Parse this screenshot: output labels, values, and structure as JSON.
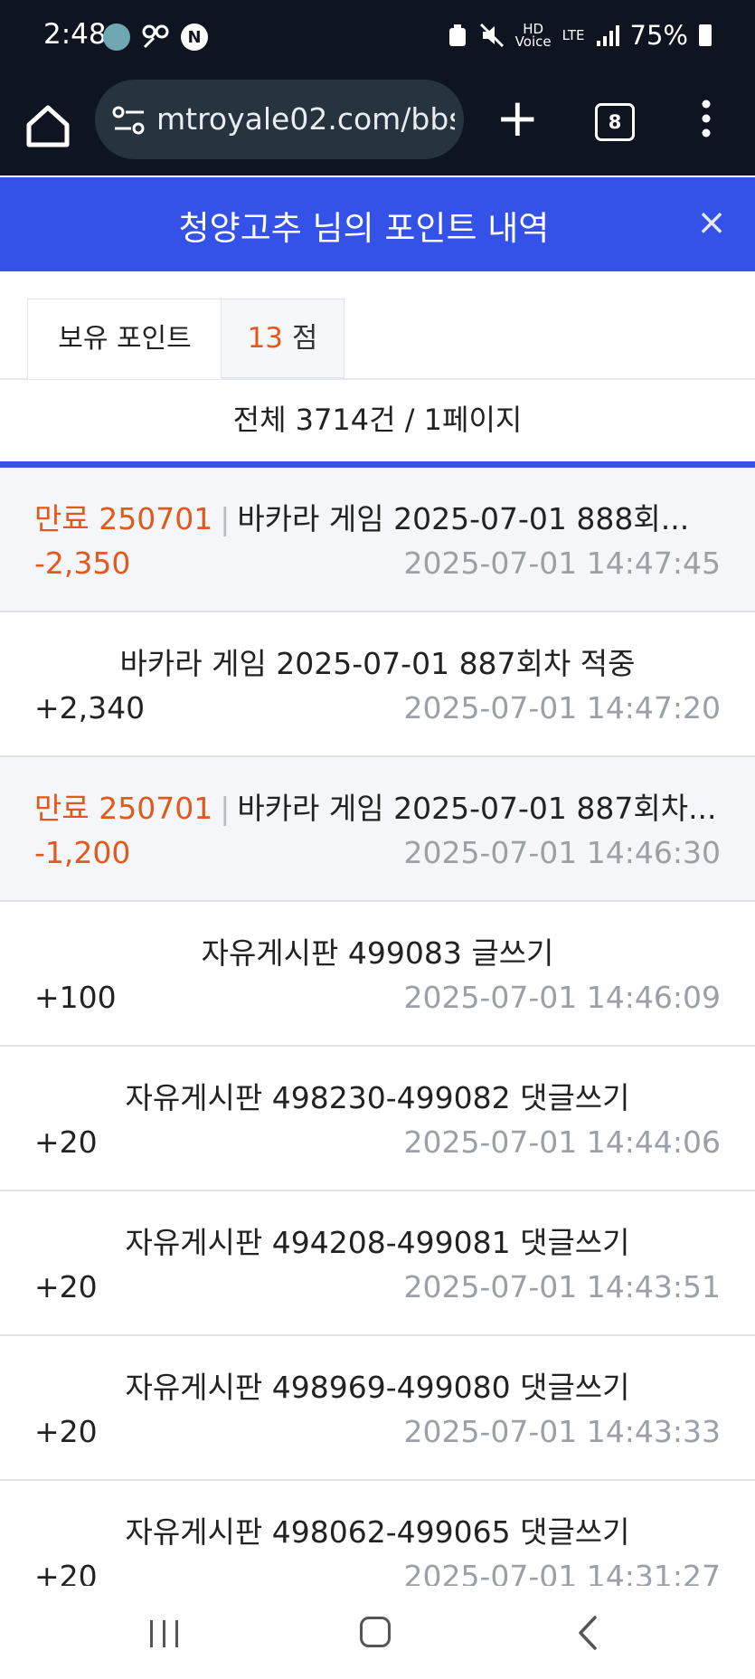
{
  "status_bar": {
    "time": "2:48",
    "hd_voice": "HD\nVoice",
    "network": "LTE",
    "battery": "75%"
  },
  "browser": {
    "url": "mtroyale02.com/bbs",
    "tab_count": "8"
  },
  "header": {
    "title": "청양고추 님의 포인트 내역",
    "close": "×"
  },
  "tabs": {
    "label": "보유 포인트",
    "points_value": "13",
    "points_unit": "점"
  },
  "summary": "전체 3714건 / 1페이지",
  "rows": [
    {
      "tag": "만료 250701",
      "desc": "바카라 게임 2025-07-01 888회...",
      "amount": "-2,350",
      "time": "2025-07-01 14:47:45",
      "negative": true
    },
    {
      "tag": "",
      "desc": "바카라 게임 2025-07-01 887회차 적중",
      "amount": "+2,340",
      "time": "2025-07-01 14:47:20",
      "negative": false
    },
    {
      "tag": "만료 250701",
      "desc": "바카라 게임 2025-07-01 887회차...",
      "amount": "-1,200",
      "time": "2025-07-01 14:46:30",
      "negative": true
    },
    {
      "tag": "",
      "desc": "자유게시판 499083 글쓰기",
      "amount": "+100",
      "time": "2025-07-01 14:46:09",
      "negative": false
    },
    {
      "tag": "",
      "desc": "자유게시판 498230-499082 댓글쓰기",
      "amount": "+20",
      "time": "2025-07-01 14:44:06",
      "negative": false
    },
    {
      "tag": "",
      "desc": "자유게시판 494208-499081 댓글쓰기",
      "amount": "+20",
      "time": "2025-07-01 14:43:51",
      "negative": false
    },
    {
      "tag": "",
      "desc": "자유게시판 498969-499080 댓글쓰기",
      "amount": "+20",
      "time": "2025-07-01 14:43:33",
      "negative": false
    },
    {
      "tag": "",
      "desc": "자유게시판 498062-499065 댓글쓰기",
      "amount": "+20",
      "time": "2025-07-01 14:31:27",
      "negative": false
    }
  ],
  "colors": {
    "header_bg": "#3552e8",
    "accent_orange": "#e2581d",
    "statusbar_bg": "#0f1520"
  }
}
